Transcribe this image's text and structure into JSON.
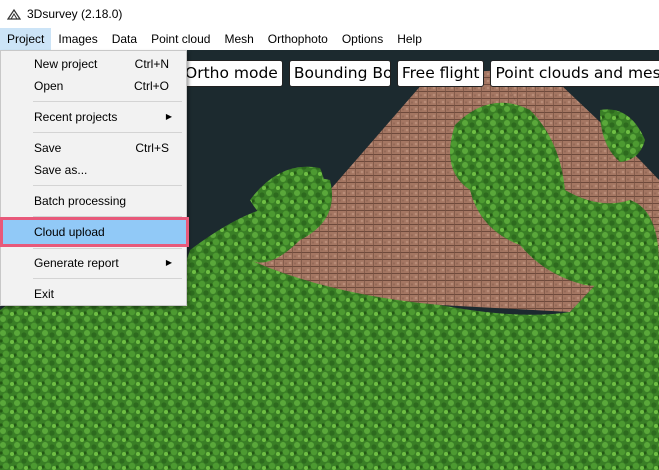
{
  "window": {
    "title": "3Dsurvey (2.18.0)"
  },
  "menubar": [
    "Project",
    "Images",
    "Data",
    "Point cloud",
    "Mesh",
    "Orthophoto",
    "Options",
    "Help"
  ],
  "view_buttons": [
    "Ortho mode",
    "Bounding Box",
    "Free flight",
    "Point clouds and meshes"
  ],
  "project_menu": {
    "new_project": {
      "label": "New project",
      "shortcut": "Ctrl+N"
    },
    "open": {
      "label": "Open",
      "shortcut": "Ctrl+O"
    },
    "recent_projects": {
      "label": "Recent projects"
    },
    "save": {
      "label": "Save",
      "shortcut": "Ctrl+S"
    },
    "save_as": {
      "label": "Save as..."
    },
    "batch_processing": {
      "label": "Batch processing"
    },
    "cloud_upload": {
      "label": "Cloud upload"
    },
    "generate_report": {
      "label": "Generate report"
    },
    "exit": {
      "label": "Exit"
    }
  },
  "colors": {
    "highlight": "#91c9f7",
    "highlight_border": "#e8597a",
    "menu_active": "#cce4f7",
    "roof": "#a87a66",
    "foliage": "#3d8a2a"
  }
}
